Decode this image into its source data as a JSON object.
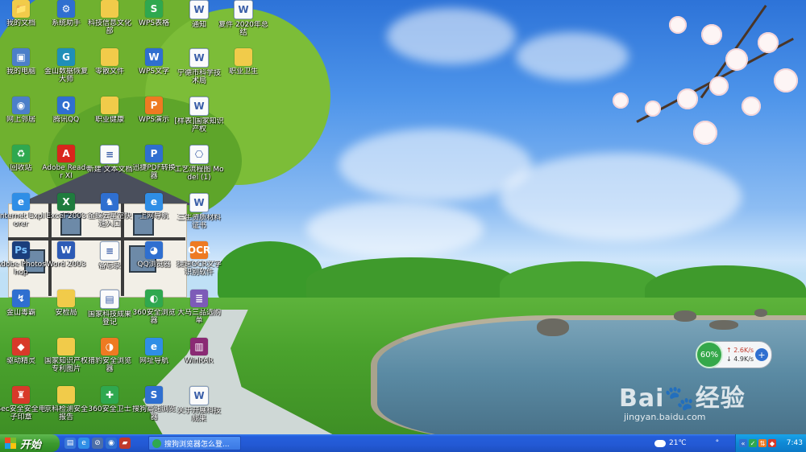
{
  "desktop": {
    "icons": [
      {
        "label": "我的文档",
        "glyph": "📁",
        "style": "g-folder",
        "col": 0,
        "row": 0
      },
      {
        "label": "系统助手",
        "glyph": "⚙",
        "style": "g-blue",
        "col": 1,
        "row": 0
      },
      {
        "label": "科技信息文化部",
        "glyph": "",
        "style": "g-folder",
        "col": 2,
        "row": 0
      },
      {
        "label": "WPS表格",
        "glyph": "S",
        "style": "g-green",
        "col": 3,
        "row": 0
      },
      {
        "label": "通知",
        "glyph": "W",
        "style": "g-doc",
        "col": 4,
        "row": 0
      },
      {
        "label": "复件 2020年总结",
        "glyph": "W",
        "style": "g-doc",
        "col": 5,
        "row": 0
      },
      {
        "label": "我的电脑",
        "glyph": "▣",
        "style": "g-comp",
        "col": 0,
        "row": 1
      },
      {
        "label": "金山数据恢复大师",
        "glyph": "G",
        "style": "g-teal",
        "col": 1,
        "row": 1
      },
      {
        "label": "零散文件",
        "glyph": "",
        "style": "g-folder",
        "col": 2,
        "row": 1
      },
      {
        "label": "WPS文字",
        "glyph": "W",
        "style": "g-blue",
        "col": 3,
        "row": 1
      },
      {
        "label": "宁德市科学技术局",
        "glyph": "W",
        "style": "g-doc",
        "col": 4,
        "row": 1
      },
      {
        "label": "职业卫生",
        "glyph": "",
        "style": "g-folder",
        "col": 5,
        "row": 1
      },
      {
        "label": "网上邻居",
        "glyph": "◉",
        "style": "g-comp",
        "col": 0,
        "row": 2
      },
      {
        "label": "腾讯QQ",
        "glyph": "Q",
        "style": "g-blue",
        "col": 1,
        "row": 2
      },
      {
        "label": "职业健康",
        "glyph": "",
        "style": "g-folder",
        "col": 2,
        "row": 2
      },
      {
        "label": "WPS演示",
        "glyph": "P",
        "style": "g-orange",
        "col": 3,
        "row": 2
      },
      {
        "label": "[样表]国家知识产权",
        "glyph": "W",
        "style": "g-doc",
        "col": 4,
        "row": 2
      },
      {
        "label": "回收站",
        "glyph": "♻",
        "style": "g-green",
        "col": 0,
        "row": 3
      },
      {
        "label": "Adobe Reader XI",
        "glyph": "A",
        "style": "g-pdf",
        "col": 1,
        "row": 3
      },
      {
        "label": "新建 文本文档",
        "glyph": "≡",
        "style": "g-doc",
        "col": 2,
        "row": 3
      },
      {
        "label": "迅捷PDF转换器",
        "glyph": "P",
        "style": "g-blue",
        "col": 3,
        "row": 3
      },
      {
        "label": "工艺流程图 Model (1)",
        "glyph": "⎔",
        "style": "g-doc",
        "col": 4,
        "row": 3
      },
      {
        "label": "Internet Explorer",
        "glyph": "e",
        "style": "g-ie",
        "col": 0,
        "row": 4
      },
      {
        "label": "Excel 2003",
        "glyph": "X",
        "style": "g-excel",
        "col": 1,
        "row": 4
      },
      {
        "label": "金蝶云星空快速入口",
        "glyph": "♞",
        "style": "g-blue",
        "col": 2,
        "row": 4
      },
      {
        "label": "上网导航",
        "glyph": "e",
        "style": "g-ie",
        "col": 3,
        "row": 4
      },
      {
        "label": "三生资质材料证书",
        "glyph": "W",
        "style": "g-doc",
        "col": 4,
        "row": 4
      },
      {
        "label": "Adobe Photoshop",
        "glyph": "Ps",
        "style": "g-ps",
        "col": 0,
        "row": 5
      },
      {
        "label": "Word 2003",
        "glyph": "W",
        "style": "g-word",
        "col": 1,
        "row": 5
      },
      {
        "label": "备忘录",
        "glyph": "≡",
        "style": "g-doc",
        "col": 2,
        "row": 5
      },
      {
        "label": "QQ浏览器",
        "glyph": "◕",
        "style": "g-blue",
        "col": 3,
        "row": 5
      },
      {
        "label": "捷速OCR文字识别软件",
        "glyph": "OCR",
        "style": "g-orange",
        "col": 4,
        "row": 5
      },
      {
        "label": "金山毒霸",
        "glyph": "↯",
        "style": "g-blue",
        "col": 0,
        "row": 6
      },
      {
        "label": "安检局",
        "glyph": "",
        "style": "g-folder",
        "col": 1,
        "row": 6
      },
      {
        "label": "国家科技成果登记",
        "glyph": "▤",
        "style": "g-doc",
        "col": 2,
        "row": 6
      },
      {
        "label": "360安全浏览器",
        "glyph": "◐",
        "style": "g-green",
        "col": 3,
        "row": 6
      },
      {
        "label": "大马三品选购单",
        "glyph": "≣",
        "style": "g-purple",
        "col": 4,
        "row": 6
      },
      {
        "label": "驱动精灵",
        "glyph": "◆",
        "style": "g-red",
        "col": 0,
        "row": 7
      },
      {
        "label": "国家知识产权专利图片",
        "glyph": "",
        "style": "g-folder",
        "col": 1,
        "row": 7
      },
      {
        "label": "猎豹安全浏览器",
        "glyph": "◑",
        "style": "g-orange",
        "col": 2,
        "row": 7
      },
      {
        "label": "网址导航",
        "glyph": "e",
        "style": "g-ie",
        "col": 3,
        "row": 7
      },
      {
        "label": "WinRAR",
        "glyph": "▥",
        "style": "g-rar",
        "col": 4,
        "row": 7
      },
      {
        "label": "Sec安全安全电子印章",
        "glyph": "♜",
        "style": "g-red",
        "col": 0,
        "row": 8
      },
      {
        "label": "京科检测安全报告",
        "glyph": "",
        "style": "g-folder",
        "col": 1,
        "row": 8
      },
      {
        "label": "360安全卫士",
        "glyph": "✚",
        "style": "g-green",
        "col": 2,
        "row": 8
      },
      {
        "label": "搜狗高速浏览器",
        "glyph": "S",
        "style": "g-blue",
        "col": 3,
        "row": 8
      },
      {
        "label": "关于开展科技成果",
        "glyph": "W",
        "style": "g-doc",
        "col": 4,
        "row": 8
      }
    ]
  },
  "network_widget": {
    "percent": "60%",
    "upload": "2.6K/s",
    "download": "4.9K/s",
    "boost_icon": "+"
  },
  "watermark": {
    "logo": "Bai🐾经验",
    "url": "jingyan.baidu.com"
  },
  "taskbar": {
    "start_label": "开始",
    "quick_launch": [
      {
        "name": "show-desktop-icon",
        "glyph": "▤",
        "color": "#3a78d8"
      },
      {
        "name": "ie-icon",
        "glyph": "e",
        "color": "#2f8ee6"
      },
      {
        "name": "no-entry-icon",
        "glyph": "⊘",
        "color": "#4d6fa8"
      },
      {
        "name": "browser-icon",
        "glyph": "◉",
        "color": "#2f6fd0"
      },
      {
        "name": "lock-icon",
        "glyph": "▰",
        "color": "#c0392b"
      }
    ],
    "active_task": "搜狗浏览器怎么登...",
    "weather": "21℃",
    "weather_extra": "°",
    "clock": "7:43"
  },
  "colors": {
    "taskbar": "#245edb",
    "start": "#3c9a2f",
    "tray": "#0f89d6"
  }
}
